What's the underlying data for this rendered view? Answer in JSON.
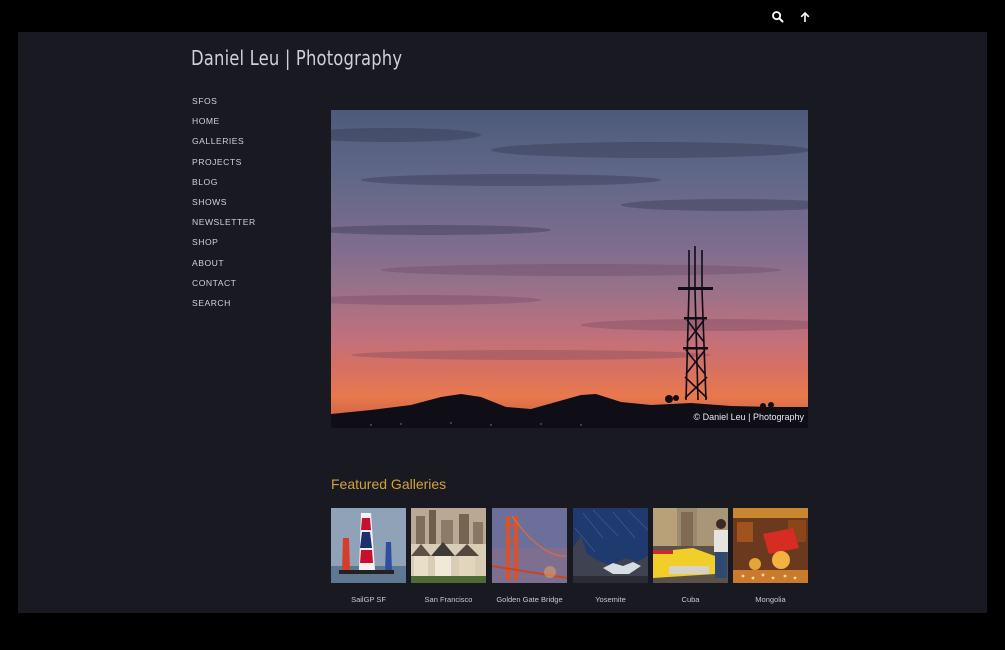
{
  "topbar": {
    "icons": [
      "search-icon",
      "arrow-up-icon"
    ]
  },
  "site": {
    "title": "Daniel Leu | Photography"
  },
  "nav": {
    "items": [
      "SFOS",
      "HOME",
      "GALLERIES",
      "PROJECTS",
      "BLOG",
      "SHOWS",
      "NEWSLETTER",
      "SHOP",
      "ABOUT",
      "CONTACT",
      "SEARCH"
    ]
  },
  "hero": {
    "credit": "© Daniel Leu | Photography"
  },
  "featured": {
    "title": "Featured Galleries",
    "galleries": [
      {
        "label": "SailGP SF"
      },
      {
        "label": "San Francisco"
      },
      {
        "label": "Golden Gate Bridge"
      },
      {
        "label": "Yosemite"
      },
      {
        "label": "Cuba"
      },
      {
        "label": "Mongolia"
      }
    ]
  },
  "colors": {
    "page_bg": "#191922",
    "outer_bg": "#000000",
    "accent": "#d2a238",
    "nav_text": "#d0d0d6"
  }
}
